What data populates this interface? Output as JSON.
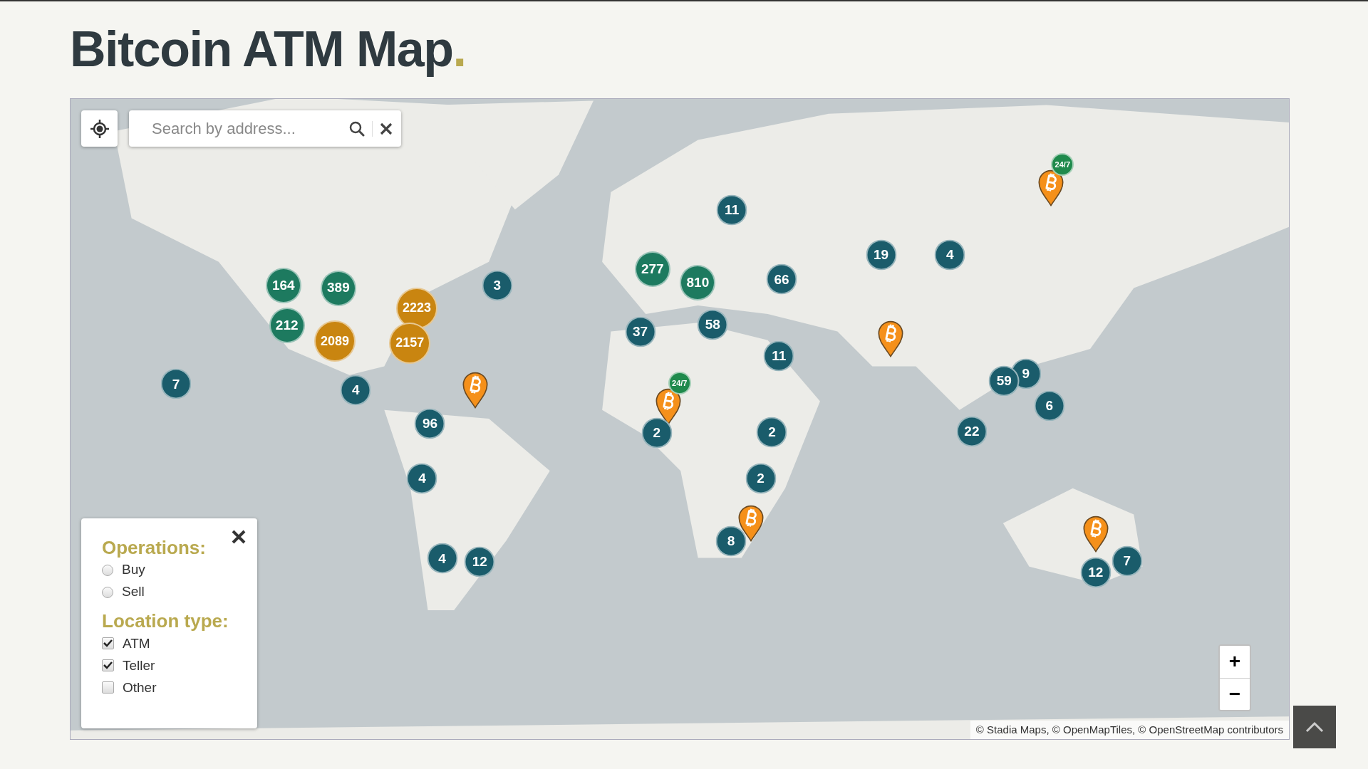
{
  "title": {
    "text": "Bitcoin ATM Map",
    "accent": "."
  },
  "search": {
    "placeholder": "Search by address..."
  },
  "markers": [
    {
      "kind": "pin",
      "badge": "24/7"
    },
    {
      "kind": "cluster",
      "label": "11",
      "color": "#1a5c6b"
    },
    {
      "kind": "cluster",
      "label": "19",
      "color": "#1a5c6b"
    },
    {
      "kind": "cluster",
      "label": "4",
      "color": "#1a5c6b"
    },
    {
      "kind": "cluster",
      "label": "277",
      "color": "#1d7a5f"
    },
    {
      "kind": "cluster",
      "label": "164",
      "color": "#1d7a5f"
    },
    {
      "kind": "cluster",
      "label": "389",
      "color": "#1d7a5f"
    },
    {
      "kind": "cluster",
      "label": "3",
      "color": "#1a5c6b"
    },
    {
      "kind": "cluster",
      "label": "810",
      "color": "#1d7a5f"
    },
    {
      "kind": "cluster",
      "label": "66",
      "color": "#1a5c6b"
    },
    {
      "kind": "cluster",
      "label": "2223",
      "color": "#c98510"
    },
    {
      "kind": "cluster",
      "label": "212",
      "color": "#1d7a5f"
    },
    {
      "kind": "cluster",
      "label": "37",
      "color": "#1a5c6b"
    },
    {
      "kind": "cluster",
      "label": "58",
      "color": "#1a5c6b"
    },
    {
      "kind": "cluster",
      "label": "2089",
      "color": "#c98510"
    },
    {
      "kind": "cluster",
      "label": "2157",
      "color": "#c98510"
    },
    {
      "kind": "pin"
    },
    {
      "kind": "cluster",
      "label": "11",
      "color": "#1a5c6b"
    },
    {
      "kind": "cluster",
      "label": "9",
      "color": "#1a5c6b"
    },
    {
      "kind": "cluster",
      "label": "7",
      "color": "#1a5c6b"
    },
    {
      "kind": "cluster",
      "label": "4",
      "color": "#1a5c6b"
    },
    {
      "kind": "pin"
    },
    {
      "kind": "pin",
      "badge": "24/7"
    },
    {
      "kind": "cluster",
      "label": "59",
      "color": "#1a5c6b"
    },
    {
      "kind": "cluster",
      "label": "6",
      "color": "#1a5c6b"
    },
    {
      "kind": "cluster",
      "label": "96",
      "color": "#1a5c6b"
    },
    {
      "kind": "cluster",
      "label": "2",
      "color": "#1a5c6b"
    },
    {
      "kind": "cluster",
      "label": "2",
      "color": "#1a5c6b"
    },
    {
      "kind": "cluster",
      "label": "22",
      "color": "#1a5c6b"
    },
    {
      "kind": "cluster",
      "label": "4",
      "color": "#1a5c6b"
    },
    {
      "kind": "cluster",
      "label": "2",
      "color": "#1a5c6b"
    },
    {
      "kind": "pin"
    },
    {
      "kind": "pin"
    },
    {
      "kind": "cluster",
      "label": "8",
      "color": "#1a5c6b"
    },
    {
      "kind": "cluster",
      "label": "4",
      "color": "#1a5c6b"
    },
    {
      "kind": "cluster",
      "label": "12",
      "color": "#1a5c6b"
    },
    {
      "kind": "cluster",
      "label": "7",
      "color": "#1a5c6b"
    },
    {
      "kind": "cluster",
      "label": "12",
      "color": "#1a5c6b"
    }
  ],
  "filters": {
    "groups": [
      {
        "heading": "Operations:",
        "options": [
          {
            "kind": "radio",
            "label": "Buy",
            "selected": false
          },
          {
            "kind": "radio",
            "label": "Sell",
            "selected": false
          }
        ]
      },
      {
        "heading": "Location type:",
        "options": [
          {
            "kind": "checkbox",
            "label": "ATM",
            "checked": true
          },
          {
            "kind": "checkbox",
            "label": "Teller",
            "checked": true
          },
          {
            "kind": "checkbox",
            "label": "Other",
            "checked": false
          }
        ]
      }
    ]
  },
  "zoom": {
    "in": "+",
    "out": "−"
  },
  "attribution": "© Stadia Maps, © OpenMapTiles, © OpenStreetMap contributors"
}
